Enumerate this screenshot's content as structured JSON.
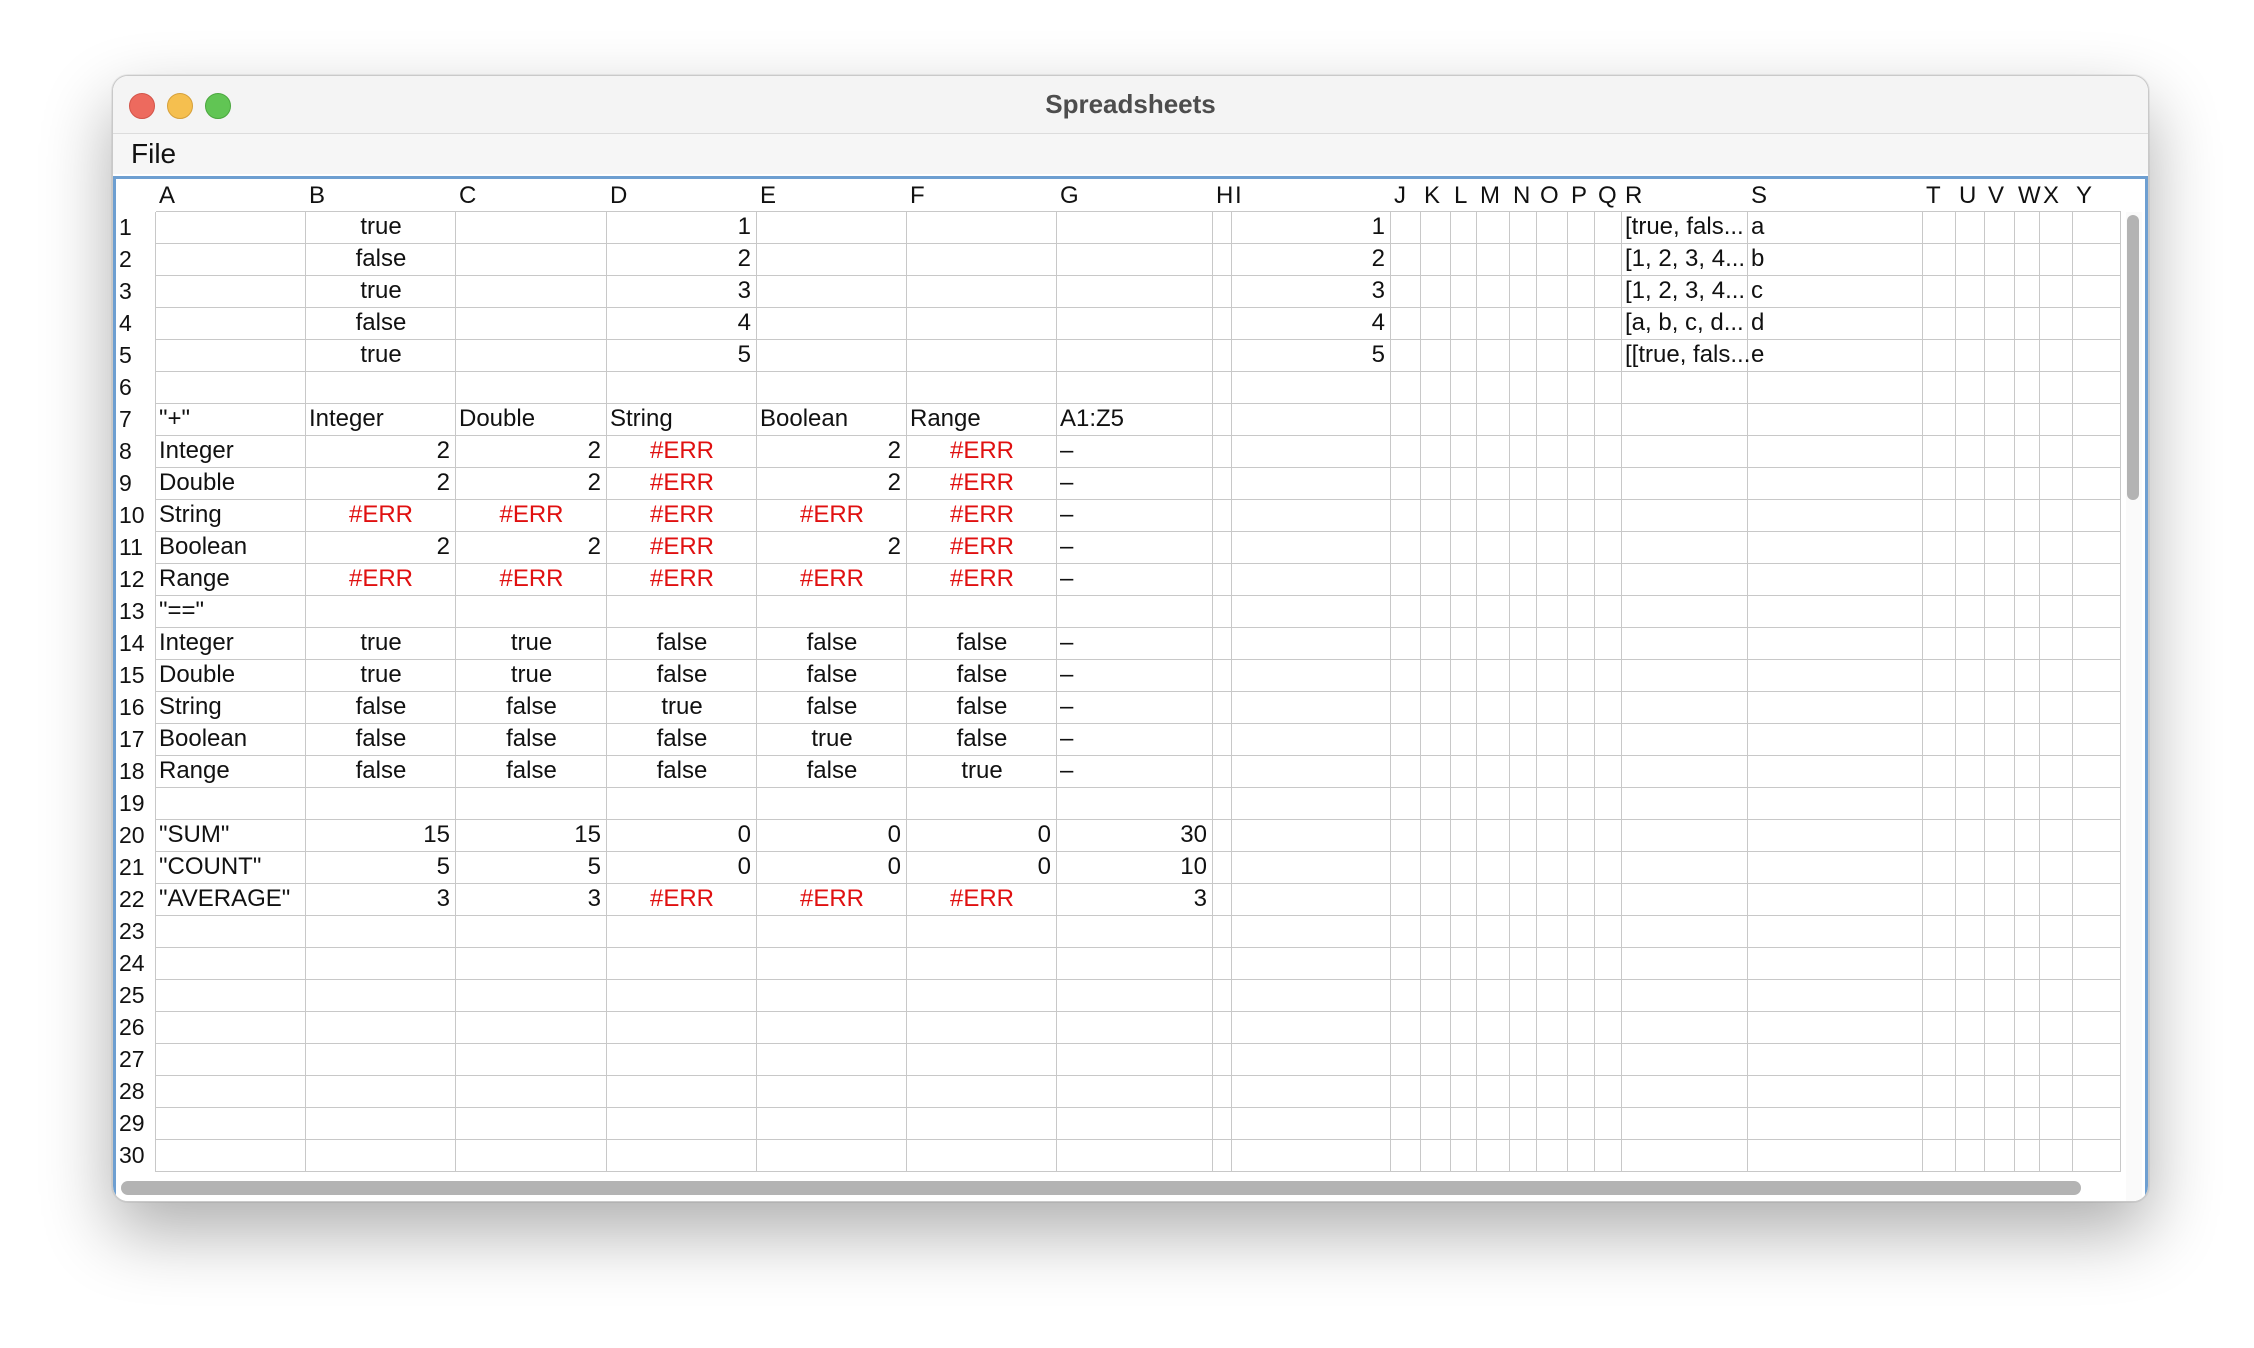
{
  "window": {
    "title": "Spreadsheets"
  },
  "menu": {
    "file_label": "File"
  },
  "columns": [
    "A",
    "B",
    "C",
    "D",
    "E",
    "F",
    "G",
    "H",
    "I",
    "J",
    "K",
    "L",
    "M",
    "N",
    "O",
    "P",
    "Q",
    "R",
    "S",
    "T",
    "U",
    "V",
    "W",
    "X",
    "Y"
  ],
  "row_numbers": [
    "1",
    "2",
    "3",
    "4",
    "5",
    "6",
    "7",
    "8",
    "9",
    "10",
    "11",
    "12",
    "13",
    "14",
    "15",
    "16",
    "17",
    "18",
    "19",
    "20",
    "21",
    "22",
    "23",
    "24",
    "25",
    "26",
    "27",
    "28",
    "29",
    "30"
  ],
  "cells": [
    {
      "row": 1,
      "col": "B",
      "text": "true",
      "align": "center"
    },
    {
      "row": 2,
      "col": "B",
      "text": "false",
      "align": "center"
    },
    {
      "row": 3,
      "col": "B",
      "text": "true",
      "align": "center"
    },
    {
      "row": 4,
      "col": "B",
      "text": "false",
      "align": "center"
    },
    {
      "row": 5,
      "col": "B",
      "text": "true",
      "align": "center"
    },
    {
      "row": 1,
      "col": "D",
      "text": "1",
      "align": "right"
    },
    {
      "row": 2,
      "col": "D",
      "text": "2",
      "align": "right"
    },
    {
      "row": 3,
      "col": "D",
      "text": "3",
      "align": "right"
    },
    {
      "row": 4,
      "col": "D",
      "text": "4",
      "align": "right"
    },
    {
      "row": 5,
      "col": "D",
      "text": "5",
      "align": "right"
    },
    {
      "row": 1,
      "col": "I",
      "text": "1",
      "align": "right"
    },
    {
      "row": 2,
      "col": "I",
      "text": "2",
      "align": "right"
    },
    {
      "row": 3,
      "col": "I",
      "text": "3",
      "align": "right"
    },
    {
      "row": 4,
      "col": "I",
      "text": "4",
      "align": "right"
    },
    {
      "row": 5,
      "col": "I",
      "text": "5",
      "align": "right"
    },
    {
      "row": 1,
      "col": "R",
      "text": "[true, fals...",
      "align": "left"
    },
    {
      "row": 2,
      "col": "R",
      "text": "[1, 2, 3, 4...",
      "align": "left"
    },
    {
      "row": 3,
      "col": "R",
      "text": "[1, 2, 3, 4...",
      "align": "left"
    },
    {
      "row": 4,
      "col": "R",
      "text": "[a, b, c, d...",
      "align": "left"
    },
    {
      "row": 5,
      "col": "R",
      "text": "[[true, fals...",
      "align": "left"
    },
    {
      "row": 1,
      "col": "S",
      "text": "a",
      "align": "left"
    },
    {
      "row": 2,
      "col": "S",
      "text": "b",
      "align": "left"
    },
    {
      "row": 3,
      "col": "S",
      "text": "c",
      "align": "left"
    },
    {
      "row": 4,
      "col": "S",
      "text": "d",
      "align": "left"
    },
    {
      "row": 5,
      "col": "S",
      "text": "e",
      "align": "left"
    },
    {
      "row": 7,
      "col": "A",
      "text": "\"+\"",
      "align": "left"
    },
    {
      "row": 7,
      "col": "B",
      "text": "Integer",
      "align": "left"
    },
    {
      "row": 7,
      "col": "C",
      "text": "Double",
      "align": "left"
    },
    {
      "row": 7,
      "col": "D",
      "text": "String",
      "align": "left"
    },
    {
      "row": 7,
      "col": "E",
      "text": "Boolean",
      "align": "left"
    },
    {
      "row": 7,
      "col": "F",
      "text": "Range",
      "align": "left"
    },
    {
      "row": 7,
      "col": "G",
      "text": "A1:Z5",
      "align": "left"
    },
    {
      "row": 8,
      "col": "A",
      "text": "Integer",
      "align": "left"
    },
    {
      "row": 8,
      "col": "B",
      "text": "2",
      "align": "right"
    },
    {
      "row": 8,
      "col": "C",
      "text": "2",
      "align": "right"
    },
    {
      "row": 8,
      "col": "D",
      "text": "#ERR",
      "align": "center",
      "err": true
    },
    {
      "row": 8,
      "col": "E",
      "text": "2",
      "align": "right"
    },
    {
      "row": 8,
      "col": "F",
      "text": "#ERR",
      "align": "center",
      "err": true
    },
    {
      "row": 8,
      "col": "G",
      "text": "–",
      "align": "left"
    },
    {
      "row": 9,
      "col": "A",
      "text": "Double",
      "align": "left"
    },
    {
      "row": 9,
      "col": "B",
      "text": "2",
      "align": "right"
    },
    {
      "row": 9,
      "col": "C",
      "text": "2",
      "align": "right"
    },
    {
      "row": 9,
      "col": "D",
      "text": "#ERR",
      "align": "center",
      "err": true
    },
    {
      "row": 9,
      "col": "E",
      "text": "2",
      "align": "right"
    },
    {
      "row": 9,
      "col": "F",
      "text": "#ERR",
      "align": "center",
      "err": true
    },
    {
      "row": 9,
      "col": "G",
      "text": "–",
      "align": "left"
    },
    {
      "row": 10,
      "col": "A",
      "text": "String",
      "align": "left"
    },
    {
      "row": 10,
      "col": "B",
      "text": "#ERR",
      "align": "center",
      "err": true
    },
    {
      "row": 10,
      "col": "C",
      "text": "#ERR",
      "align": "center",
      "err": true
    },
    {
      "row": 10,
      "col": "D",
      "text": "#ERR",
      "align": "center",
      "err": true
    },
    {
      "row": 10,
      "col": "E",
      "text": "#ERR",
      "align": "center",
      "err": true
    },
    {
      "row": 10,
      "col": "F",
      "text": "#ERR",
      "align": "center",
      "err": true
    },
    {
      "row": 10,
      "col": "G",
      "text": "–",
      "align": "left"
    },
    {
      "row": 11,
      "col": "A",
      "text": "Boolean",
      "align": "left"
    },
    {
      "row": 11,
      "col": "B",
      "text": "2",
      "align": "right"
    },
    {
      "row": 11,
      "col": "C",
      "text": "2",
      "align": "right"
    },
    {
      "row": 11,
      "col": "D",
      "text": "#ERR",
      "align": "center",
      "err": true
    },
    {
      "row": 11,
      "col": "E",
      "text": "2",
      "align": "right"
    },
    {
      "row": 11,
      "col": "F",
      "text": "#ERR",
      "align": "center",
      "err": true
    },
    {
      "row": 11,
      "col": "G",
      "text": "–",
      "align": "left"
    },
    {
      "row": 12,
      "col": "A",
      "text": "Range",
      "align": "left"
    },
    {
      "row": 12,
      "col": "B",
      "text": "#ERR",
      "align": "center",
      "err": true
    },
    {
      "row": 12,
      "col": "C",
      "text": "#ERR",
      "align": "center",
      "err": true
    },
    {
      "row": 12,
      "col": "D",
      "text": "#ERR",
      "align": "center",
      "err": true
    },
    {
      "row": 12,
      "col": "E",
      "text": "#ERR",
      "align": "center",
      "err": true
    },
    {
      "row": 12,
      "col": "F",
      "text": "#ERR",
      "align": "center",
      "err": true
    },
    {
      "row": 12,
      "col": "G",
      "text": "–",
      "align": "left"
    },
    {
      "row": 13,
      "col": "A",
      "text": "\"==\"",
      "align": "left"
    },
    {
      "row": 14,
      "col": "A",
      "text": "Integer",
      "align": "left"
    },
    {
      "row": 14,
      "col": "B",
      "text": "true",
      "align": "center"
    },
    {
      "row": 14,
      "col": "C",
      "text": "true",
      "align": "center"
    },
    {
      "row": 14,
      "col": "D",
      "text": "false",
      "align": "center"
    },
    {
      "row": 14,
      "col": "E",
      "text": "false",
      "align": "center"
    },
    {
      "row": 14,
      "col": "F",
      "text": "false",
      "align": "center"
    },
    {
      "row": 14,
      "col": "G",
      "text": "–",
      "align": "left"
    },
    {
      "row": 15,
      "col": "A",
      "text": "Double",
      "align": "left"
    },
    {
      "row": 15,
      "col": "B",
      "text": "true",
      "align": "center"
    },
    {
      "row": 15,
      "col": "C",
      "text": "true",
      "align": "center"
    },
    {
      "row": 15,
      "col": "D",
      "text": "false",
      "align": "center"
    },
    {
      "row": 15,
      "col": "E",
      "text": "false",
      "align": "center"
    },
    {
      "row": 15,
      "col": "F",
      "text": "false",
      "align": "center"
    },
    {
      "row": 15,
      "col": "G",
      "text": "–",
      "align": "left"
    },
    {
      "row": 16,
      "col": "A",
      "text": "String",
      "align": "left"
    },
    {
      "row": 16,
      "col": "B",
      "text": "false",
      "align": "center"
    },
    {
      "row": 16,
      "col": "C",
      "text": "false",
      "align": "center"
    },
    {
      "row": 16,
      "col": "D",
      "text": "true",
      "align": "center"
    },
    {
      "row": 16,
      "col": "E",
      "text": "false",
      "align": "center"
    },
    {
      "row": 16,
      "col": "F",
      "text": "false",
      "align": "center"
    },
    {
      "row": 16,
      "col": "G",
      "text": "–",
      "align": "left"
    },
    {
      "row": 17,
      "col": "A",
      "text": "Boolean",
      "align": "left"
    },
    {
      "row": 17,
      "col": "B",
      "text": "false",
      "align": "center"
    },
    {
      "row": 17,
      "col": "C",
      "text": "false",
      "align": "center"
    },
    {
      "row": 17,
      "col": "D",
      "text": "false",
      "align": "center"
    },
    {
      "row": 17,
      "col": "E",
      "text": "true",
      "align": "center"
    },
    {
      "row": 17,
      "col": "F",
      "text": "false",
      "align": "center"
    },
    {
      "row": 17,
      "col": "G",
      "text": "–",
      "align": "left"
    },
    {
      "row": 18,
      "col": "A",
      "text": "Range",
      "align": "left"
    },
    {
      "row": 18,
      "col": "B",
      "text": "false",
      "align": "center"
    },
    {
      "row": 18,
      "col": "C",
      "text": "false",
      "align": "center"
    },
    {
      "row": 18,
      "col": "D",
      "text": "false",
      "align": "center"
    },
    {
      "row": 18,
      "col": "E",
      "text": "false",
      "align": "center"
    },
    {
      "row": 18,
      "col": "F",
      "text": "true",
      "align": "center"
    },
    {
      "row": 18,
      "col": "G",
      "text": "–",
      "align": "left"
    },
    {
      "row": 20,
      "col": "A",
      "text": "\"SUM\"",
      "align": "left"
    },
    {
      "row": 20,
      "col": "B",
      "text": "15",
      "align": "right"
    },
    {
      "row": 20,
      "col": "C",
      "text": "15",
      "align": "right"
    },
    {
      "row": 20,
      "col": "D",
      "text": "0",
      "align": "right"
    },
    {
      "row": 20,
      "col": "E",
      "text": "0",
      "align": "right"
    },
    {
      "row": 20,
      "col": "F",
      "text": "0",
      "align": "right"
    },
    {
      "row": 20,
      "col": "G",
      "text": "30",
      "align": "right"
    },
    {
      "row": 21,
      "col": "A",
      "text": "\"COUNT\"",
      "align": "left"
    },
    {
      "row": 21,
      "col": "B",
      "text": "5",
      "align": "right"
    },
    {
      "row": 21,
      "col": "C",
      "text": "5",
      "align": "right"
    },
    {
      "row": 21,
      "col": "D",
      "text": "0",
      "align": "right"
    },
    {
      "row": 21,
      "col": "E",
      "text": "0",
      "align": "right"
    },
    {
      "row": 21,
      "col": "F",
      "text": "0",
      "align": "right"
    },
    {
      "row": 21,
      "col": "G",
      "text": "10",
      "align": "right"
    },
    {
      "row": 22,
      "col": "A",
      "text": "\"AVERAGE\"",
      "align": "left"
    },
    {
      "row": 22,
      "col": "B",
      "text": "3",
      "align": "right"
    },
    {
      "row": 22,
      "col": "C",
      "text": "3",
      "align": "right"
    },
    {
      "row": 22,
      "col": "D",
      "text": "#ERR",
      "align": "center",
      "err": true
    },
    {
      "row": 22,
      "col": "E",
      "text": "#ERR",
      "align": "center",
      "err": true
    },
    {
      "row": 22,
      "col": "F",
      "text": "#ERR",
      "align": "center",
      "err": true
    },
    {
      "row": 22,
      "col": "G",
      "text": "3",
      "align": "right"
    }
  ]
}
